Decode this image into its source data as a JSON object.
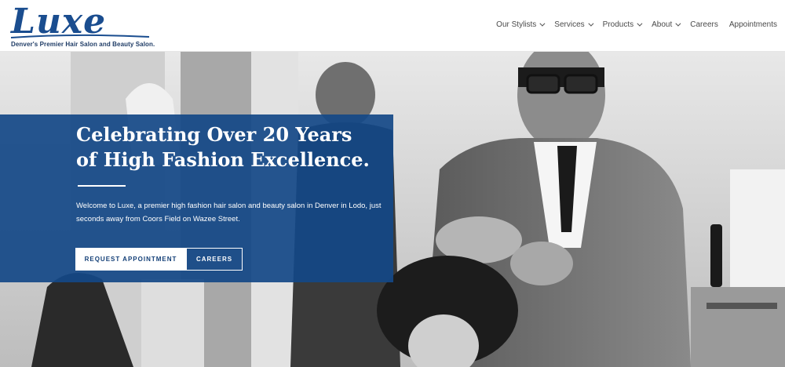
{
  "brand": {
    "logo_text": "Luxe",
    "tagline": "Denver's Premier Hair Salon and Beauty Salon."
  },
  "nav": {
    "items": [
      {
        "label": "Our Stylists",
        "has_dropdown": true
      },
      {
        "label": "Services",
        "has_dropdown": true
      },
      {
        "label": "Products",
        "has_dropdown": true
      },
      {
        "label": "About",
        "has_dropdown": true
      },
      {
        "label": "Careers",
        "has_dropdown": false
      },
      {
        "label": "Appointments",
        "has_dropdown": false
      }
    ]
  },
  "hero": {
    "title": "Celebrating Over 20 Years of High Fashion Excellence.",
    "text": "Welcome to Luxe, a premier high fashion hair salon and beauty salon in Denver in Lodo, just seconds away from Coors Field on Wazee Street.",
    "primary_button": "REQUEST APPOINTMENT",
    "secondary_button": "CAREERS"
  },
  "colors": {
    "brand_blue": "#1a4d8f",
    "panel_blue": "#134887",
    "nav_text": "#4a4a4a"
  }
}
